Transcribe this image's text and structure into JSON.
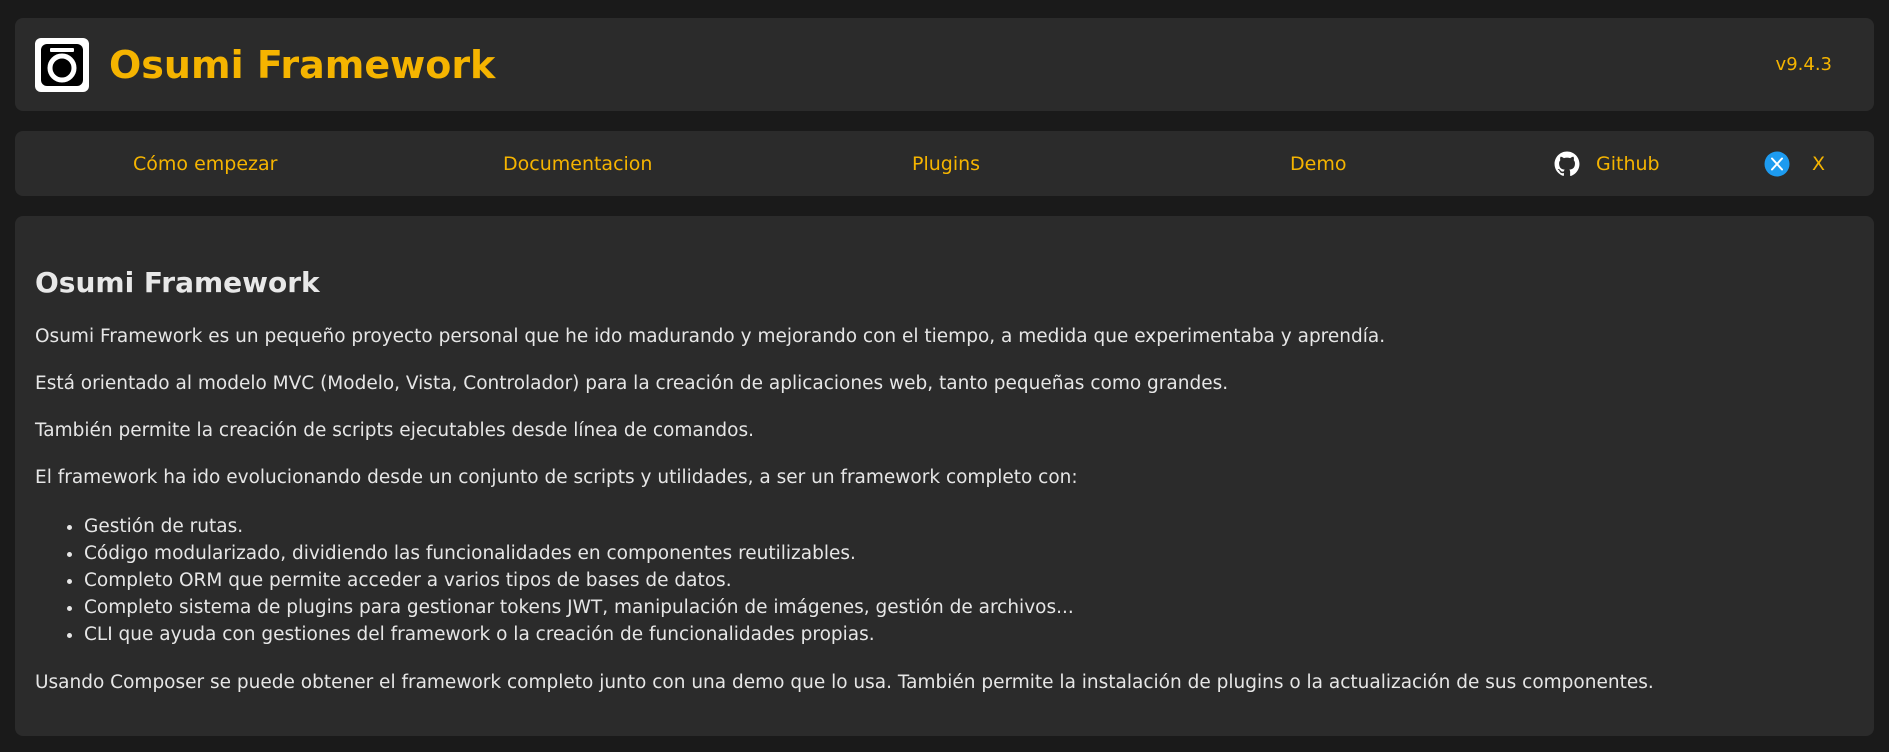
{
  "header": {
    "title": "Osumi Framework",
    "version": "v9.4.3",
    "logo_icon": "osumi-logo-icon"
  },
  "nav": {
    "items": [
      {
        "label": "Cómo empezar"
      },
      {
        "label": "Documentacion"
      },
      {
        "label": "Plugins"
      },
      {
        "label": "Demo"
      },
      {
        "label": "Github",
        "icon": "github-icon"
      },
      {
        "label": "X",
        "icon": "twitter-icon"
      }
    ]
  },
  "content": {
    "heading": "Osumi Framework",
    "paragraphs": [
      "Osumi Framework es un pequeño proyecto personal que he ido madurando y mejorando con el tiempo, a medida que experimentaba y aprendía.",
      "Está orientado al modelo MVC (Modelo, Vista, Controlador) para la creación de aplicaciones web, tanto pequeñas como grandes.",
      "También permite la creación de scripts ejecutables desde línea de comandos.",
      "El framework ha ido evolucionando desde un conjunto de scripts y utilidades, a ser un framework completo con:"
    ],
    "features": [
      "Gestión de rutas.",
      "Código modularizado, dividiendo las funcionalidades en componentes reutilizables.",
      "Completo ORM que permite acceder a varios tipos de bases de datos.",
      "Completo sistema de plugins para gestionar tokens JWT, manipulación de imágenes, gestión de archivos...",
      "CLI que ayuda con gestiones del framework o la creación de funcionalidades propias."
    ],
    "closing": "Usando Composer se puede obtener el framework completo junto con una demo que lo usa. También permite la instalación de plugins o la actualización de sus componentes."
  },
  "colors": {
    "accent": "#f5b400",
    "background": "#1a1a1a",
    "card": "#2b2b2b",
    "text": "#e6e6e6",
    "twitter": "#1d9bf0"
  }
}
